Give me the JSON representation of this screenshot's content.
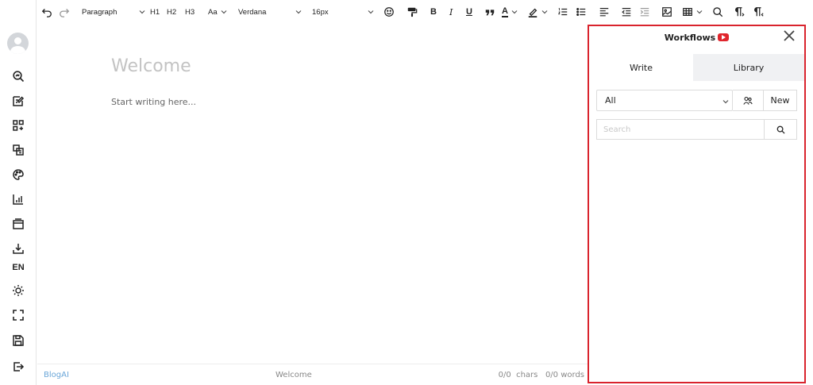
{
  "toolbar": {
    "undo_icon": "undo-icon",
    "redo_icon": "redo-icon",
    "block_format": "Paragraph",
    "h1": "H1",
    "h2": "H2",
    "h3": "H3",
    "case": "Aa",
    "font_family": "Verdana",
    "font_size": "16px",
    "bold": "B",
    "italic": "I",
    "underline": "U",
    "font_color": "A"
  },
  "sidebar": {
    "language": "EN",
    "items": [
      "user-avatar",
      "seo-search-icon",
      "edit-note-icon",
      "apps-add-icon",
      "copy-layers-icon",
      "palette-icon",
      "bar-chart-icon",
      "window-icon",
      "download-icon",
      "language",
      "sun-icon",
      "fullscreen-icon",
      "save-icon",
      "exit-icon"
    ]
  },
  "editor": {
    "title_placeholder": "Welcome",
    "body_placeholder": "Start writing here..."
  },
  "status": {
    "brand": "BlogAI",
    "doc_title": "Welcome",
    "chars": "0/0  chars",
    "words": "0/0 words"
  },
  "workflows": {
    "title": "Workflows",
    "tabs": [
      "Write",
      "Library"
    ],
    "active_tab": "Library",
    "filter_value": "All",
    "new_label": "New",
    "search_placeholder": "Search"
  },
  "colors": {
    "panel_border": "#d9232d",
    "brand_link": "#6aa6d8",
    "youtube_red": "#e0262d"
  }
}
